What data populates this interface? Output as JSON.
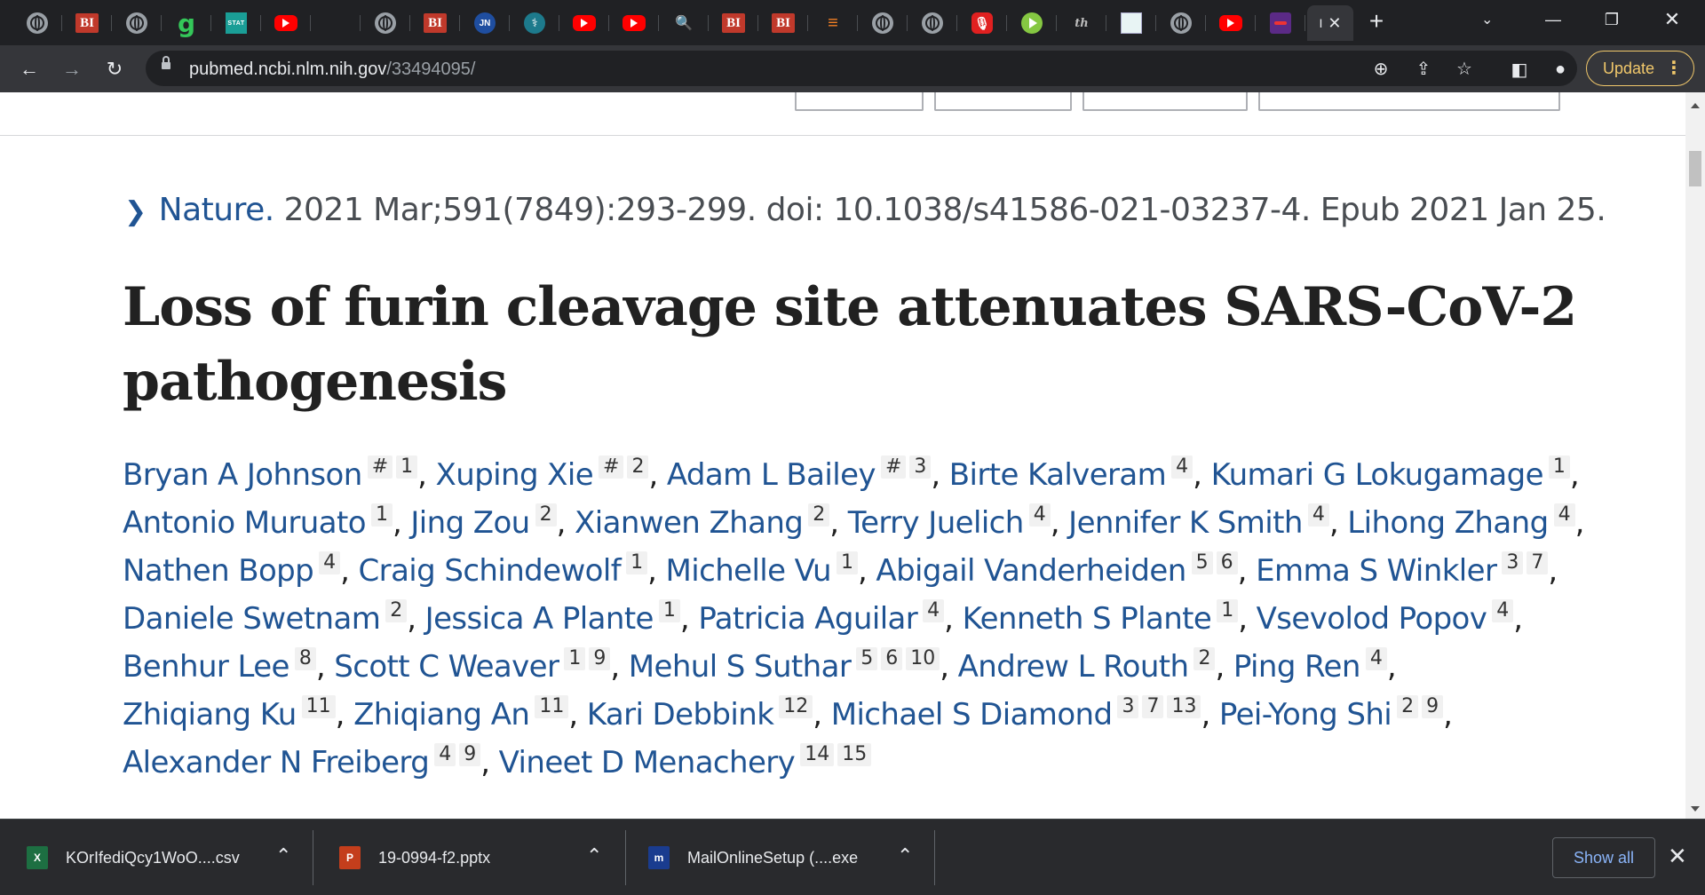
{
  "browser": {
    "tabs": [
      {
        "icon": "globe-wiki-icon",
        "text": ""
      },
      {
        "icon": "bi-icon",
        "text": "BI"
      },
      {
        "icon": "globe-icon",
        "text": ""
      },
      {
        "icon": "g-icon",
        "text": "g"
      },
      {
        "icon": "stat-icon",
        "text": "STAT"
      },
      {
        "icon": "youtube-icon",
        "text": ""
      },
      {
        "icon": "blank-icon",
        "text": ""
      },
      {
        "icon": "globe-icon",
        "text": ""
      },
      {
        "icon": "bi-icon",
        "text": "BI"
      },
      {
        "icon": "jn-icon",
        "text": "JN"
      },
      {
        "icon": "medical-icon",
        "text": "⚕"
      },
      {
        "icon": "youtube-icon",
        "text": ""
      },
      {
        "icon": "youtube-icon",
        "text": ""
      },
      {
        "icon": "search-icon",
        "text": "🔍"
      },
      {
        "icon": "bi-icon",
        "text": "BI"
      },
      {
        "icon": "bi-icon",
        "text": "BI"
      },
      {
        "icon": "stackoverflow-icon",
        "text": "≡"
      },
      {
        "icon": "globe-icon",
        "text": ""
      },
      {
        "icon": "globe-icon",
        "text": ""
      },
      {
        "icon": "microphone-icon",
        "text": "🎙"
      },
      {
        "icon": "rumble-icon",
        "text": ""
      },
      {
        "icon": "italic-logo-icon",
        "text": "th"
      },
      {
        "icon": "image-icon",
        "text": ""
      },
      {
        "icon": "globe-icon",
        "text": ""
      },
      {
        "icon": "youtube-icon",
        "text": ""
      },
      {
        "icon": "purple-logo-icon",
        "text": ""
      }
    ],
    "active_tab_label": "I",
    "url_domain": "pubmed.ncbi.nlm.nih.gov",
    "url_path": "/33494095/",
    "update_label": "Update"
  },
  "article": {
    "journal": "Nature.",
    "citation_rest": " 2021 Mar;591(7849):293-299. doi: 10.1038/s41586-021-03237-4. Epub 2021 Jan 25.",
    "title": "Loss of furin cleavage site attenuates SARS-CoV-2 pathogenesis",
    "authors": [
      {
        "name": "Bryan A Johnson",
        "sups": [
          "#",
          "1"
        ]
      },
      {
        "name": "Xuping Xie",
        "sups": [
          "#",
          "2"
        ]
      },
      {
        "name": "Adam L Bailey",
        "sups": [
          "#",
          "3"
        ]
      },
      {
        "name": "Birte Kalveram",
        "sups": [
          "4"
        ]
      },
      {
        "name": "Kumari G Lokugamage",
        "sups": [
          "1"
        ]
      },
      {
        "name": "Antonio Muruato",
        "sups": [
          "1"
        ]
      },
      {
        "name": "Jing Zou",
        "sups": [
          "2"
        ]
      },
      {
        "name": "Xianwen Zhang",
        "sups": [
          "2"
        ]
      },
      {
        "name": "Terry Juelich",
        "sups": [
          "4"
        ]
      },
      {
        "name": "Jennifer K Smith",
        "sups": [
          "4"
        ]
      },
      {
        "name": "Lihong Zhang",
        "sups": [
          "4"
        ]
      },
      {
        "name": "Nathen Bopp",
        "sups": [
          "4"
        ]
      },
      {
        "name": "Craig Schindewolf",
        "sups": [
          "1"
        ]
      },
      {
        "name": "Michelle Vu",
        "sups": [
          "1"
        ]
      },
      {
        "name": "Abigail Vanderheiden",
        "sups": [
          "5",
          "6"
        ]
      },
      {
        "name": "Emma S Winkler",
        "sups": [
          "3",
          "7"
        ]
      },
      {
        "name": "Daniele Swetnam",
        "sups": [
          "2"
        ]
      },
      {
        "name": "Jessica A Plante",
        "sups": [
          "1"
        ]
      },
      {
        "name": "Patricia Aguilar",
        "sups": [
          "4"
        ]
      },
      {
        "name": "Kenneth S Plante",
        "sups": [
          "1"
        ]
      },
      {
        "name": "Vsevolod Popov",
        "sups": [
          "4"
        ]
      },
      {
        "name": "Benhur Lee",
        "sups": [
          "8"
        ]
      },
      {
        "name": "Scott C Weaver",
        "sups": [
          "1",
          "9"
        ]
      },
      {
        "name": "Mehul S Suthar",
        "sups": [
          "5",
          "6",
          "10"
        ]
      },
      {
        "name": "Andrew L Routh",
        "sups": [
          "2"
        ]
      },
      {
        "name": "Ping Ren",
        "sups": [
          "4"
        ]
      },
      {
        "name": "Zhiqiang Ku",
        "sups": [
          "11"
        ]
      },
      {
        "name": "Zhiqiang An",
        "sups": [
          "11"
        ]
      },
      {
        "name": "Kari Debbink",
        "sups": [
          "12"
        ]
      },
      {
        "name": "Michael S Diamond",
        "sups": [
          "3",
          "7",
          "13"
        ]
      },
      {
        "name": "Pei-Yong Shi",
        "sups": [
          "2",
          "9"
        ]
      },
      {
        "name": "Alexander N Freiberg",
        "sups": [
          "4",
          "9"
        ]
      },
      {
        "name": "Vineet D Menachery",
        "sups": [
          "14",
          "15"
        ]
      }
    ]
  },
  "downloads": {
    "items": [
      {
        "name": "KOrIfediQcy1WoO....csv",
        "icon": "excel-icon",
        "badge": "X",
        "color": "#1d6f42"
      },
      {
        "name": "19-0994-f2.pptx",
        "icon": "powerpoint-icon",
        "badge": "P",
        "color": "#c43e1c"
      },
      {
        "name": "MailOnlineSetup (....exe",
        "icon": "mailonline-icon",
        "badge": "m",
        "color": "#1a3c8f"
      }
    ],
    "show_all_label": "Show all"
  },
  "colors": {
    "link": "#205493",
    "tab_bar": "#202124",
    "toolbar": "#35363a",
    "update_accent": "#f1c86b"
  }
}
